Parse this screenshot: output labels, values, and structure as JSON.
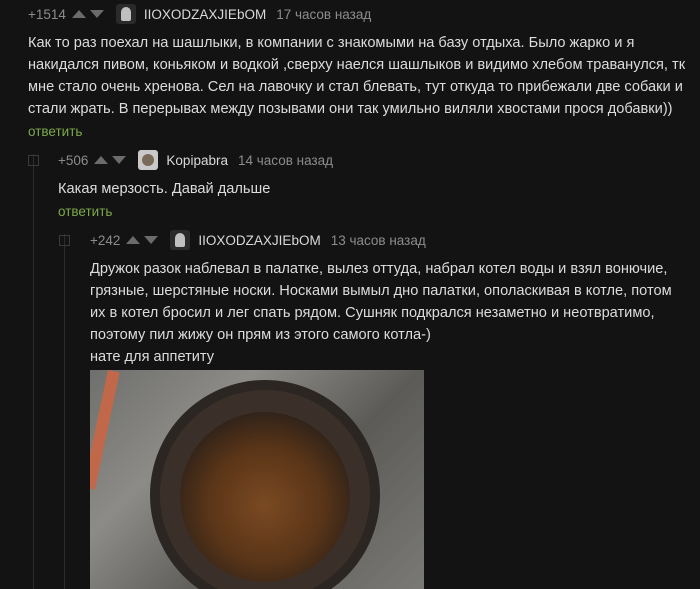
{
  "comments": [
    {
      "rating": "+1514",
      "author": "IIOXODZAXJIEbOM",
      "time": "17 часов назад",
      "text_lines": [
        "Как то раз поехал на шашлыки, в компании с знакомыми на базу отдыха. Было жарко и я",
        "накидался пивом, коньяком и водкой ,сверху наелся шашлыков и видимо хлебом траванулся, тк",
        "мне стало очень хренова. Сел на лавочку и стал блевать, тут откуда то прибежали две собаки и",
        "стали жрать. В перерывах между позывами они так умильно виляли хвостами прося добавки))"
      ],
      "reply": "ответить"
    },
    {
      "rating": "+506",
      "author": "Kopipabra",
      "time": "14 часов назад",
      "text_lines": [
        "Какая мерзость. Давай дальше"
      ],
      "reply": "ответить"
    },
    {
      "rating": "+242",
      "author": "IIOXODZAXJIEbOM",
      "time": "13 часов назад",
      "text_lines": [
        "Дружок разок наблевал в палатке, вылез оттуда, набрал котел воды и взял вонючие,",
        "грязные, шерстяные носки. Носками вымыл дно палатки, ополаскивая в котле, потом",
        "их в котел бросил и лег спать рядом. Сушняк подкрался незаметно и неотвратимо,",
        "поэтому пил жижу он прям из этого самого котла-)",
        "нате для аппетиту"
      ]
    }
  ],
  "icons": {
    "upvote": "upvote-icon",
    "downvote": "downvote-icon"
  },
  "colors": {
    "background": "#131313",
    "reply_link": "#7caa49"
  }
}
